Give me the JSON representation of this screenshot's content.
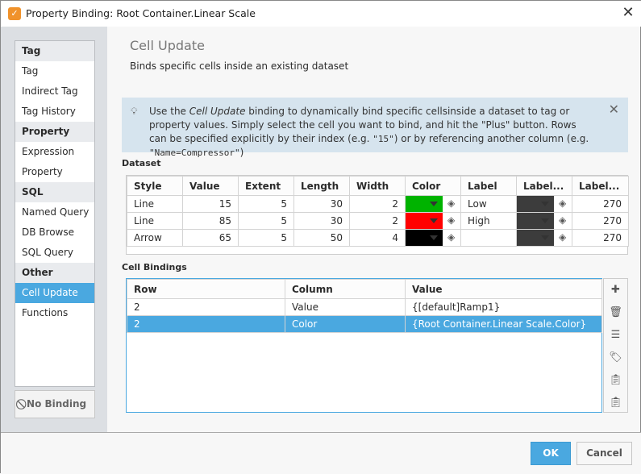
{
  "window": {
    "title": "Property Binding: Root Container.Linear Scale",
    "close": "✕"
  },
  "sidebar": {
    "items": [
      {
        "label": "Tag",
        "header": true
      },
      {
        "label": "Tag"
      },
      {
        "label": "Indirect Tag"
      },
      {
        "label": "Tag History"
      },
      {
        "label": "Property",
        "header": true
      },
      {
        "label": "Expression"
      },
      {
        "label": "Property"
      },
      {
        "label": "SQL",
        "header": true
      },
      {
        "label": "Named Query"
      },
      {
        "label": "DB Browse"
      },
      {
        "label": "SQL Query"
      },
      {
        "label": "Other",
        "header": true
      },
      {
        "label": "Cell Update",
        "selected": true
      },
      {
        "label": "Functions"
      }
    ],
    "no_binding": "No Binding"
  },
  "main": {
    "title": "Cell Update",
    "subtitle": "Binds specific cells inside an existing dataset",
    "info": {
      "t1": "Use the ",
      "em": "Cell Update",
      "t2": " binding to dynamically bind specific cellsinside a dataset to tag or property values. Simply select the cell you want to bind, and hit the \"Plus\" button. Rows can be specified explicitly by their index (e.g. ",
      "c1": "\"15\"",
      "t3": ") or by referencing another column (e.g. ",
      "c2": "\"Name=Compressor\"",
      "t4": ")"
    },
    "dataset_label": "Dataset",
    "dataset": {
      "columns": [
        "Style",
        "Value",
        "Extent",
        "Length",
        "Width",
        "Color",
        "Label",
        "Label...",
        "Label..."
      ],
      "rows": [
        {
          "style": "Line",
          "value": "15",
          "extent": "5",
          "length": "30",
          "width": "2",
          "color": "#00b300",
          "label": "Low",
          "label_color": "#3c3c3c",
          "label_angle": "270"
        },
        {
          "style": "Line",
          "value": "85",
          "extent": "5",
          "length": "30",
          "width": "2",
          "color": "#ff0000",
          "label": "High",
          "label_color": "#3c3c3c",
          "label_angle": "270"
        },
        {
          "style": "Arrow",
          "value": "65",
          "extent": "5",
          "length": "50",
          "width": "4",
          "color": "#000000",
          "label": "",
          "label_color": "#3c3c3c",
          "label_angle": "270"
        }
      ]
    },
    "bindings_label": "Cell Bindings",
    "bindings": {
      "columns": [
        "Row",
        "Column",
        "Value"
      ],
      "rows": [
        {
          "row": "2",
          "column": "Value",
          "value": "{[default]Ramp1}"
        },
        {
          "row": "2",
          "column": "Color",
          "value": "{Root Container.Linear Scale.Color}",
          "selected": true
        }
      ]
    },
    "tools": [
      "add-icon",
      "delete-icon",
      "edit-icon",
      "tag-icon",
      "paste-binding-icon",
      "clipboard-icon"
    ]
  },
  "footer": {
    "ok": "OK",
    "cancel": "Cancel"
  },
  "colors": {
    "accent": "#4aa8e0",
    "info_bg": "#d6e4ee"
  }
}
